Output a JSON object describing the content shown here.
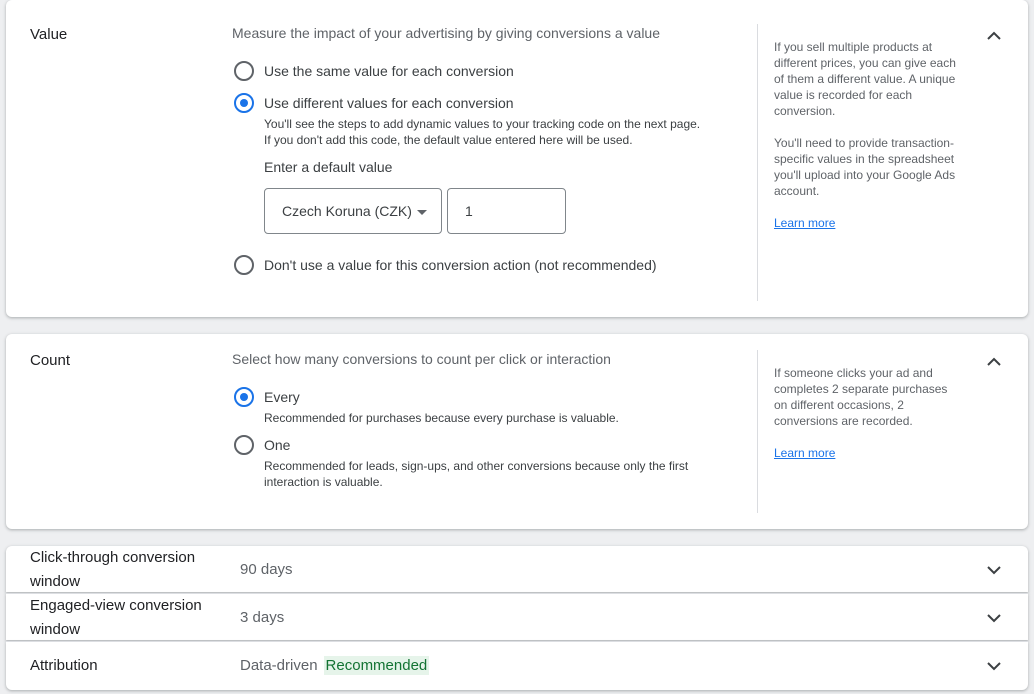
{
  "value_section": {
    "title": "Value",
    "description": "Measure the impact of your advertising by giving conversions a value",
    "options": [
      {
        "label": "Use the same value for each conversion",
        "checked": false
      },
      {
        "label": "Use different values for each conversion",
        "checked": true
      },
      {
        "label": "Don't use a value for this conversion action (not recommended)",
        "checked": false
      }
    ],
    "hint_line1": "You'll see the steps to add dynamic values to your tracking code on the next page.",
    "hint_line2": "If you don't add this code, the default value entered here will be used.",
    "default_value_label": "Enter a default value",
    "currency_selected": "Czech Koruna (CZK)",
    "default_value": "1",
    "help_p1": "If you sell multiple products at different prices, you can give each of them a different value. A unique value is recorded for each conversion.",
    "help_p2": "You'll need to provide transaction-specific values in the spreadsheet you'll upload into your Google Ads account.",
    "learn_more": "Learn more",
    "collapse_icon": "chevron-up-icon"
  },
  "count_section": {
    "title": "Count",
    "description": "Select how many conversions to count per click or interaction",
    "options": [
      {
        "label": "Every",
        "hint": "Recommended for purchases because every purchase is valuable.",
        "checked": true
      },
      {
        "label": "One",
        "hint_line1": "Recommended for leads, sign-ups, and other conversions because only the first",
        "hint_line2": "interaction is valuable.",
        "checked": false
      }
    ],
    "help": "If someone clicks your ad and completes 2 separate purchases on different occasions, 2 conversions are recorded.",
    "learn_more": "Learn more",
    "collapse_icon": "chevron-up-icon"
  },
  "click_through": {
    "title_line1": "Click-through conversion",
    "title_line2": "window",
    "value": "90 days",
    "expand_icon": "chevron-down-icon"
  },
  "engaged_view": {
    "title_line1": "Engaged-view conversion",
    "title_line2": "window",
    "value": "3 days",
    "expand_icon": "chevron-down-icon"
  },
  "attribution": {
    "title": "Attribution",
    "value": "Data-driven",
    "badge": "Recommended",
    "expand_icon": "chevron-down-icon"
  },
  "colors": {
    "accent": "#1a73e8",
    "badge_bg": "#e6f4ea",
    "badge_text": "#137333"
  }
}
